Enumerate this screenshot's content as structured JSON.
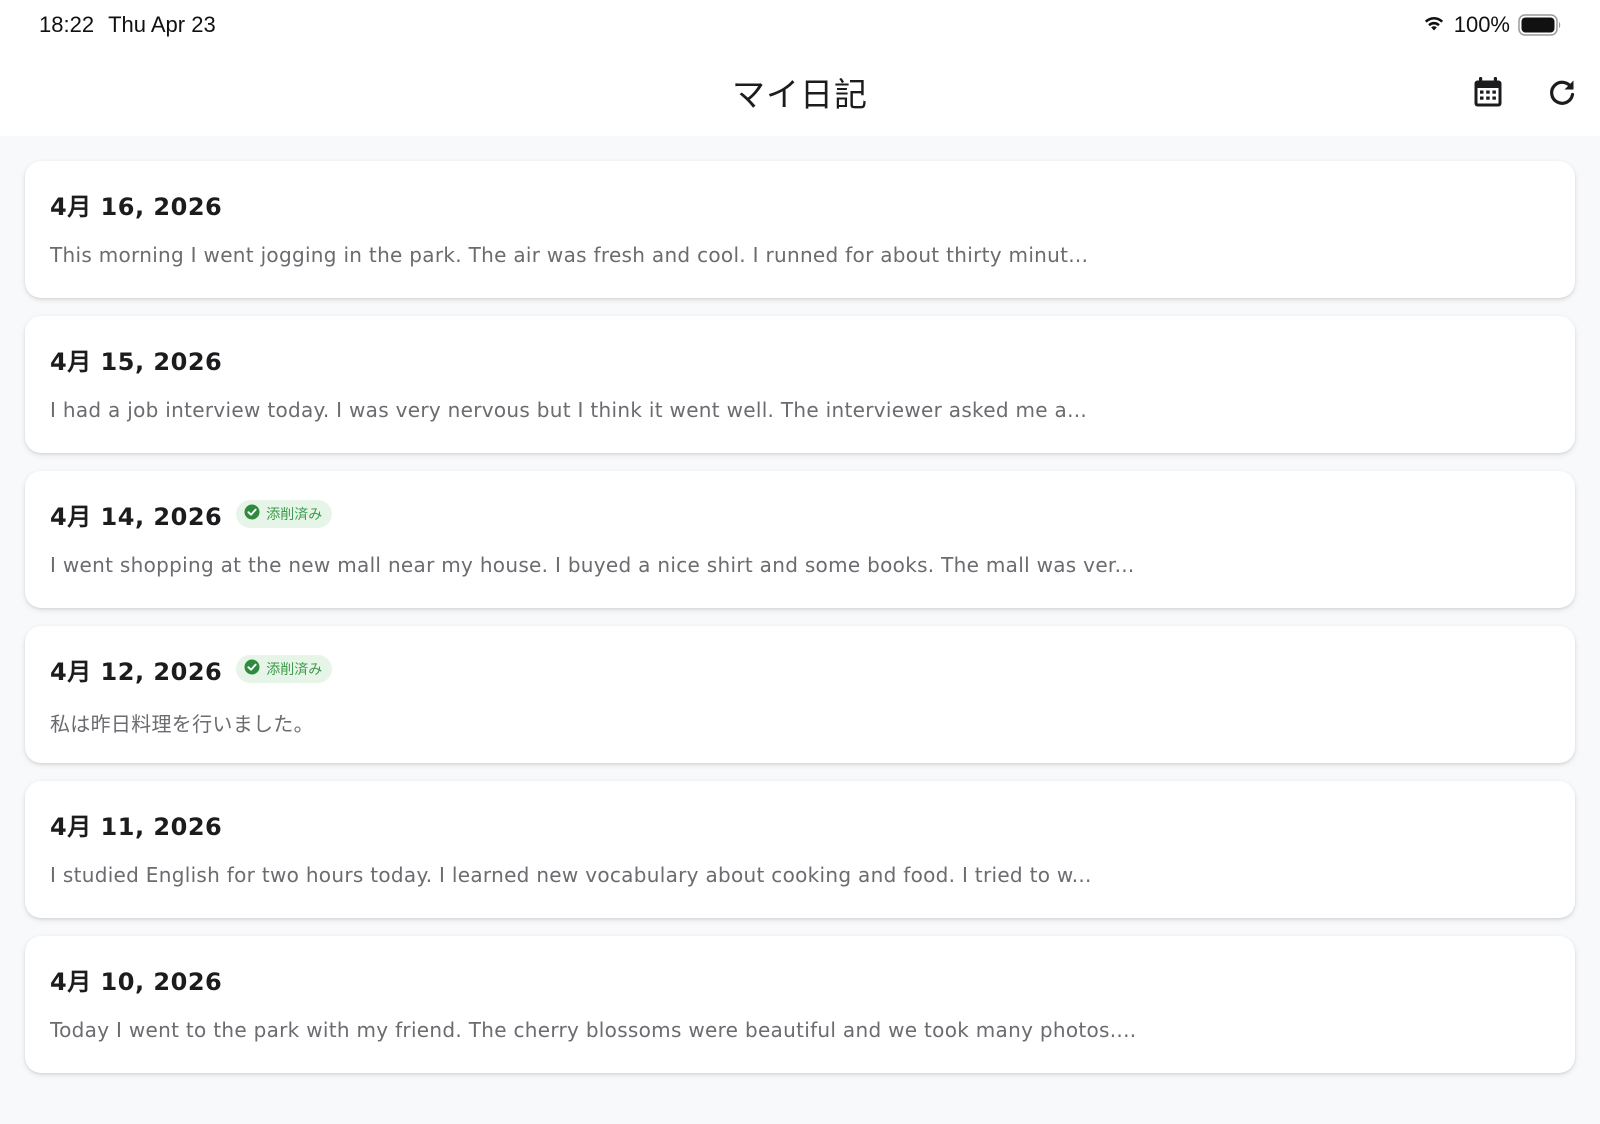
{
  "status_bar": {
    "time": "18:22",
    "date": "Thu Apr 23",
    "battery": "100%"
  },
  "app_bar": {
    "title": "マイ日記",
    "calendar_icon": "calendar-icon",
    "refresh_icon": "refresh-icon"
  },
  "colors": {
    "badge_bg": "#e7f5e9",
    "badge_fg": "#3b9a4a",
    "check": "#2e8b3e"
  },
  "entries": [
    {
      "date": "4月 16, 2026",
      "badge": "",
      "preview": "This morning I went jogging in the park. The air was fresh and cool. I runned for about thirty minut..."
    },
    {
      "date": "4月 15, 2026",
      "badge": "",
      "preview": "I had a job interview today. I was very nervous but I think it went well. The interviewer asked me a..."
    },
    {
      "date": "4月 14, 2026",
      "badge": "添削済み",
      "preview": "I went shopping at the new mall near my house. I buyed a nice shirt and some books. The mall was ver..."
    },
    {
      "date": "4月 12, 2026",
      "badge": "添削済み",
      "preview": "私は昨日料理を行いました。"
    },
    {
      "date": "4月 11, 2026",
      "badge": "",
      "preview": "I studied English for two hours today. I learned new vocabulary about cooking and food. I tried to w..."
    },
    {
      "date": "4月 10, 2026",
      "badge": "",
      "preview": "Today I went to the park with my friend. The cherry blossoms were beautiful and we took many photos...."
    }
  ]
}
